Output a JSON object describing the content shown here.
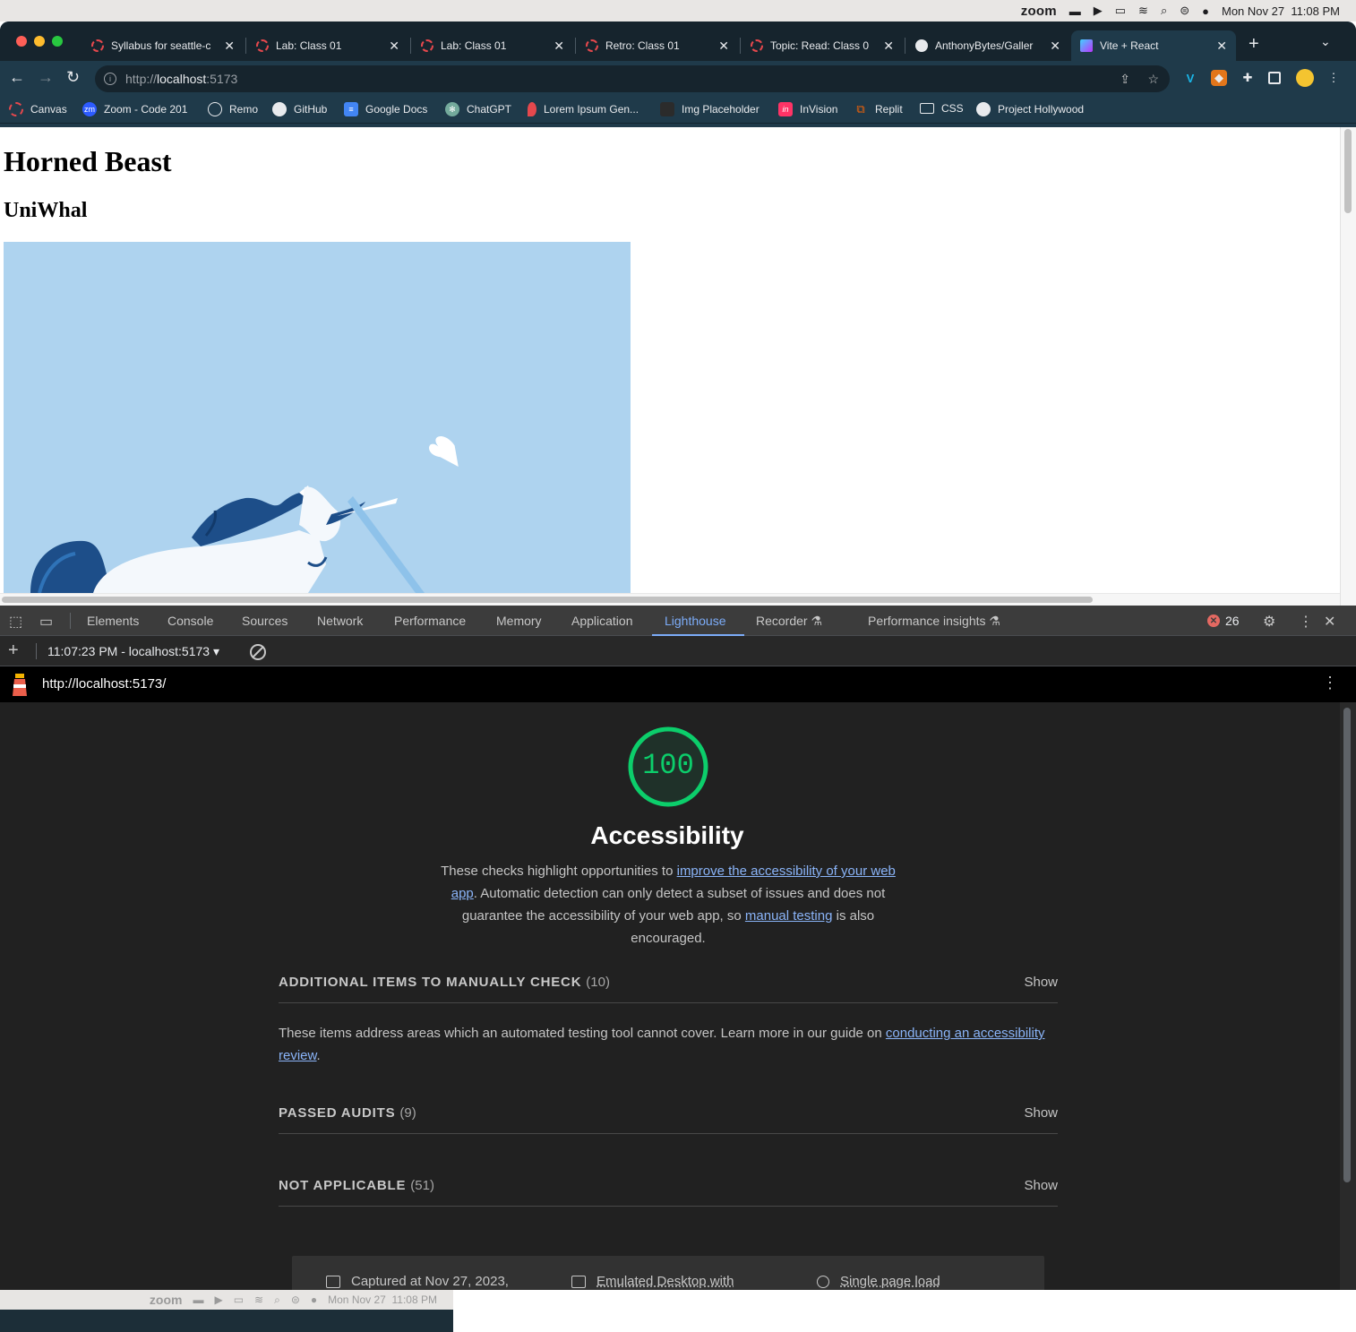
{
  "menubar": {
    "zoom": "zoom",
    "icons": [
      "car-icon",
      "play-icon",
      "battery-icon",
      "wifi-icon",
      "search-icon",
      "control-center-icon",
      "siri-icon"
    ],
    "date": "Mon Nov 27",
    "time": "11:08 PM"
  },
  "tabs": [
    {
      "title": "Syllabus for seattle-c",
      "active": false
    },
    {
      "title": "Lab: Class 01",
      "active": false
    },
    {
      "title": "Lab: Class 01",
      "active": false
    },
    {
      "title": "Retro: Class 01",
      "active": false
    },
    {
      "title": "Topic: Read: Class 0",
      "active": false
    },
    {
      "title": "AnthonyBytes/Galler",
      "active": false
    },
    {
      "title": "Vite + React",
      "active": true
    }
  ],
  "omnibox": {
    "scheme": "http://",
    "host": "localhost",
    "port": ":5173"
  },
  "bookmarks": [
    "Canvas",
    "Zoom - Code 201",
    "Remo",
    "GitHub",
    "Google Docs",
    "ChatGPT",
    "Lorem Ipsum Gen...",
    "Img Placeholder",
    "InVision",
    "Replit",
    "CSS",
    "Project Hollywood"
  ],
  "page": {
    "title": "Horned Beast",
    "beast_name": "UniWhal"
  },
  "devtools": {
    "tabs": [
      "Elements",
      "Console",
      "Sources",
      "Network",
      "Performance",
      "Memory",
      "Application",
      "Lighthouse",
      "Recorder",
      "Performance insights"
    ],
    "active_tab": "Lighthouse",
    "error_count": "26",
    "report_select": "11:07:23 PM - localhost:5173",
    "report_url": "http://localhost:5173/"
  },
  "lighthouse": {
    "score": "100",
    "score_fraction": 1.0,
    "score_color": "#0cce6b",
    "category": "Accessibility",
    "desc_1": "These checks highlight opportunities to ",
    "desc_link_1": "improve the accessibility of your web app",
    "desc_2": ". Automatic detection can only detect a subset of issues and does not guarantee the accessibility of your web app, so ",
    "desc_link_2": "manual testing",
    "desc_3": " is also encouraged.",
    "groups": [
      {
        "title": "ADDITIONAL ITEMS TO MANUALLY CHECK",
        "count": "(10)",
        "action": "Show"
      },
      {
        "title": "PASSED AUDITS",
        "count": "(9)",
        "action": "Show"
      },
      {
        "title": "NOT APPLICABLE",
        "count": "(51)",
        "action": "Show"
      }
    ],
    "manual_desc": "These items address areas which an automated testing tool cannot cover. Learn more in our guide on ",
    "manual_link": "conducting an accessibility review",
    "manual_end": ".",
    "footer": {
      "captured": "Captured at Nov 27, 2023,",
      "device": "Emulated Desktop with",
      "load": "Single page load"
    }
  },
  "bottom_strip": {
    "zoom": "zoom",
    "date": "Mon Nov 27",
    "time": "11:08 PM"
  }
}
